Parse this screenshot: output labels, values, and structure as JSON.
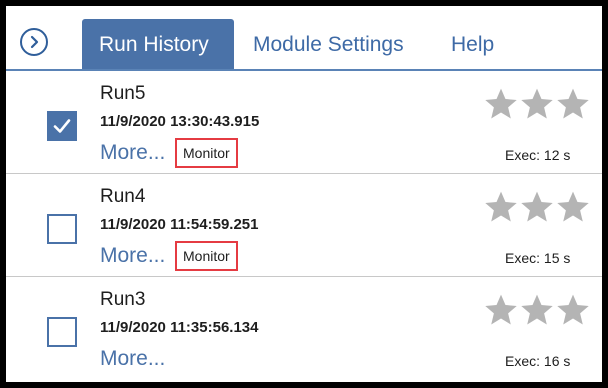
{
  "tabs": {
    "expand_icon": "chevron-right-icon",
    "items": [
      {
        "label": "Run History",
        "active": true
      },
      {
        "label": "Module Settings",
        "active": false
      },
      {
        "label": "Help",
        "active": false
      }
    ]
  },
  "runs": [
    {
      "name": "Run5",
      "timestamp": "11/9/2020 13:30:43.915",
      "more_label": "More...",
      "badge": "Monitor",
      "exec": "Exec: 12 s",
      "checked": true,
      "rating": 0,
      "rating_max": 3
    },
    {
      "name": "Run4",
      "timestamp": "11/9/2020 11:54:59.251",
      "more_label": "More...",
      "badge": "Monitor",
      "exec": "Exec: 15 s",
      "checked": false,
      "rating": 0,
      "rating_max": 3
    },
    {
      "name": "Run3",
      "timestamp": "11/9/2020 11:35:56.134",
      "more_label": "More...",
      "badge": "",
      "exec": "Exec: 16 s",
      "checked": false,
      "rating": 0,
      "rating_max": 3
    }
  ],
  "colors": {
    "accent": "#4a72a8",
    "tab_active_bg": "#4a72a8",
    "highlight_border": "#e53b42",
    "star_empty": "#b4b4b4",
    "frame": "#000000"
  }
}
